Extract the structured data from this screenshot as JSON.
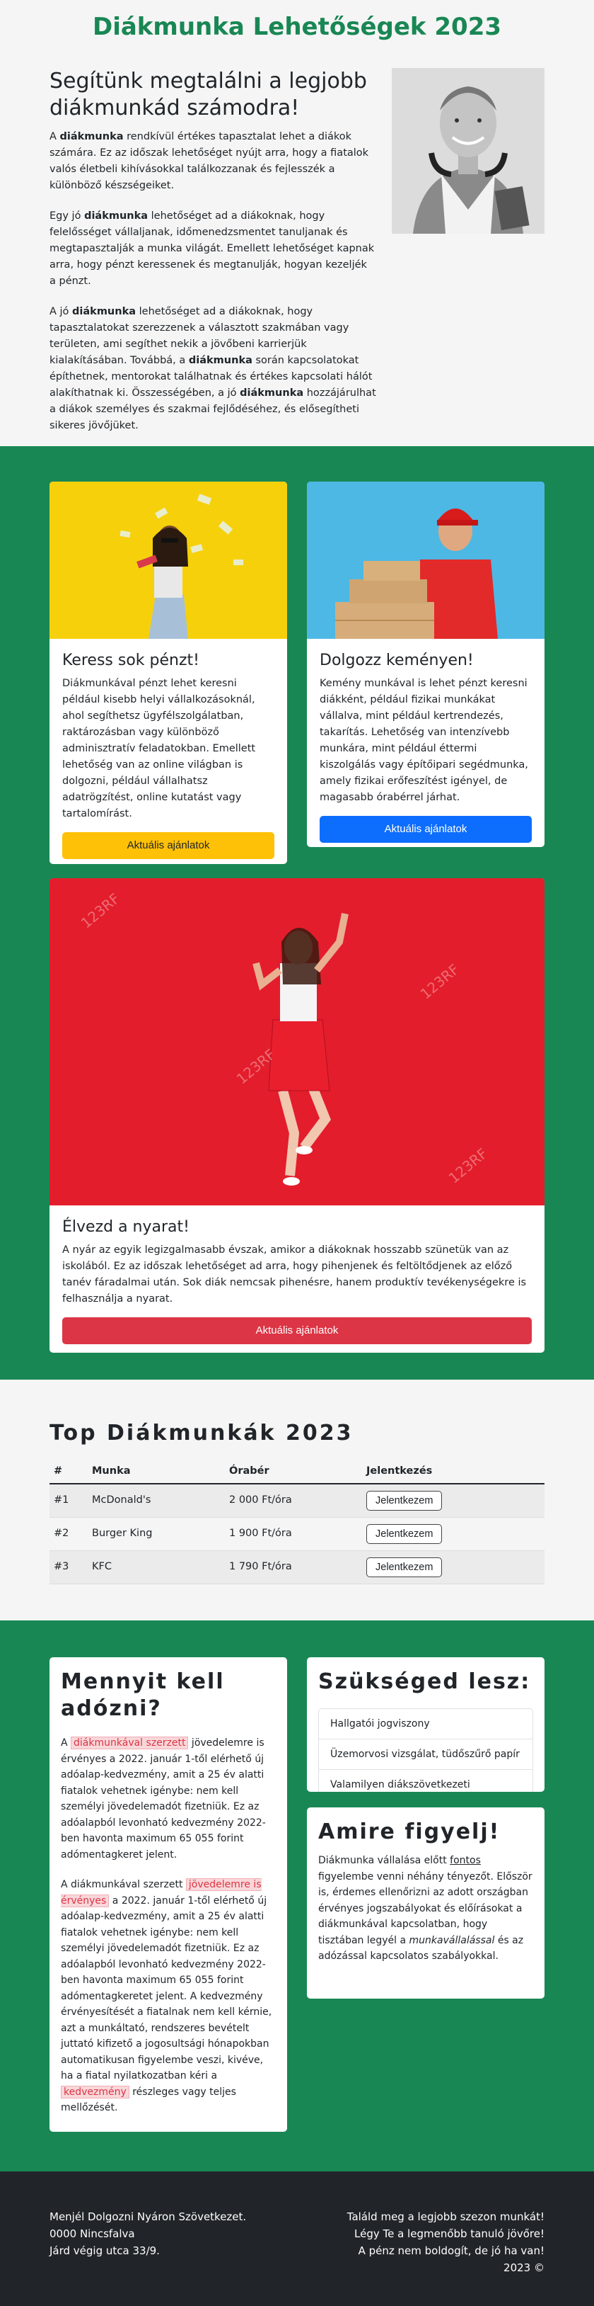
{
  "page": {
    "title": "Diákmunka Lehetőségek 2023"
  },
  "intro": {
    "heading": "Segítünk megtalálni a legjobb diákmunkád számodra!",
    "p1_a": "A ",
    "p1_b": "diákmunka",
    "p1_c": " rendkívül értékes tapasztalat lehet a diákok számára. Ez az időszak lehetőséget nyújt arra, hogy a fiatalok valós életbeli kihívásokkal találkozzanak és fejlesszék a különböző készségeiket.",
    "p2_a": "Egy jó ",
    "p2_b": "diákmunka",
    "p2_c": " lehetőséget ad a diákoknak, hogy felelősséget vállaljanak, időmenedzsmentet tanuljanak és megtapasztalják a munka világát. Emellett lehetőséget kapnak arra, hogy pénzt keressenek és megtanulják, hogyan kezeljék a pénzt.",
    "p3_a": "A jó ",
    "p3_b": "diákmunka",
    "p3_c": " lehetőséget ad a diákoknak, hogy tapasztalatokat szerezzenek a választott szakmában vagy területen, ami segíthet nekik a jövőbeni karrierjük kialakításában. Továbbá, a ",
    "p3_d": "diákmunka",
    "p3_e": " során kapcsolatokat építhetnek, mentorokat találhatnak és értékes kapcsolati hálót alakíthatnak ki. Összességében, a jó ",
    "p3_f": "diákmunka",
    "p3_g": " hozzájárulhat a diákok személyes és szakmai fejlődéséhez, és elősegítheti sikeres jövőjüket."
  },
  "cards": [
    {
      "title": "Keress sok pénzt!",
      "text": "Diákmunkával pénzt lehet keresni például kisebb helyi vállalkozásoknál, ahol segíthetsz ügyfélszolgálatban, raktározásban vagy különböző adminisztratív feladatokban. Emellett lehetőség van az online világban is dolgozni, például vállalhatsz adatrögzítést, online kutatást vagy tartalomírást.",
      "button": "Aktuális ajánlatok"
    },
    {
      "title": "Dolgozz keményen!",
      "text": "Kemény munkával is lehet pénzt keresni diákként, például fizikai munkákat vállalva, mint például kertrendezés, takarítás. Lehetőség van intenzívebb munkára, mint például éttermi kiszolgálás vagy építőipari segédmunka, amely fizikai erőfeszítést igényel, de magasabb órabérrel járhat.",
      "button": "Aktuális ajánlatok"
    },
    {
      "title": "Élvezd a nyarat!",
      "text": "A nyár az egyik legizgalmasabb évszak, amikor a diákoknak hosszabb szünetük van az iskolából. Ez az időszak lehetőséget ad arra, hogy pihenjenek és feltöltődjenek az előző tanév fáradalmai után. Sok diák nemcsak pihenésre, hanem produktív tevékenységekre is felhasználja a nyarat.",
      "button": "Aktuális ajánlatok",
      "watermark": "123RF"
    }
  ],
  "top": {
    "title": "Top Diákmunkák 2023",
    "headers": [
      "#",
      "Munka",
      "Órabér",
      "Jelentkezés"
    ],
    "rows": [
      {
        "n": "#1",
        "job": "McDonald's",
        "wage": "2 000 Ft/óra",
        "button": "Jelentkezem"
      },
      {
        "n": "#2",
        "job": "Burger King",
        "wage": "1 900 Ft/óra",
        "button": "Jelentkezem"
      },
      {
        "n": "#3",
        "job": "KFC",
        "wage": "1 790 Ft/óra",
        "button": "Jelentkezem"
      }
    ]
  },
  "tax": {
    "title": "Mennyit kell adózni?",
    "p1_a": "A ",
    "p1_hl": "diákmunkával szerzett",
    "p1_b": " jövedelemre is érvényes a 2022. január 1-től elérhető új adóalap-kedvezmény, amit a 25 év alatti fiatalok vehetnek igénybe: nem kell személyi jövedelemadót fizetniük. Ez az adóalapból levonható kedvezmény 2022-ben havonta maximum 65 055 forint adómentagkeret jelent.",
    "p2_a": "A diákmunkával szerzett ",
    "p2_hl": "jövedelemre is érvényes",
    "p2_b": " a 2022. január 1-től elérhető új adóalap-kedvezmény, amit a 25 év alatti fiatalok vehetnek igénybe: nem kell személyi jövedelemadót fizetniük. Ez az adóalapból levonható kedvezmény 2022-ben havonta maximum 65 055 forint adómentagkeretet jelent. A kedvezmény érvényesítését a fiatalnak nem kell kérnie, azt a munkáltató, rendszeres bevételt juttató kifizető a jogosultsági hónapokban automatikusan figyelembe veszi, kivéve, ha a fiatal nyilatkozatban kéri a ",
    "p2_hl2": "kedvezmény",
    "p2_c": " részleges vagy teljes mellőzését."
  },
  "need": {
    "title": "Szükséged lesz:",
    "items": [
      "Hallgatói jogviszony",
      "Üzemorvosi vizsgálat, tüdőszűrő papír",
      "Valamilyen diákszövetkezeti szerződés"
    ]
  },
  "attention": {
    "title": "Amire figyelj!",
    "a": "Diákmunka vállalása előtt ",
    "b": "fontos",
    "c": " figyelembe venni néhány tényezőt. Először is, érdemes ellenőrizni az adott országban érvényes jogszabályokat és előírásokat a diákmunkával kapcsolatban, hogy tisztában legyél a ",
    "d": "munkavállalással",
    "e": " és az adózással kapcsolatos szabályokkal."
  },
  "footer": {
    "left": [
      "Menjél Dolgozni Nyáron Szövetkezet.",
      "0000 Nincsfalva",
      "Járd végig utca 33/9."
    ],
    "right": [
      "Találd meg a legjobb szezon munkát!",
      "Légy Te a legmenőbb tanuló jövőre!",
      "A pénz nem boldogít, de jó ha van!",
      "2023 ©"
    ]
  }
}
